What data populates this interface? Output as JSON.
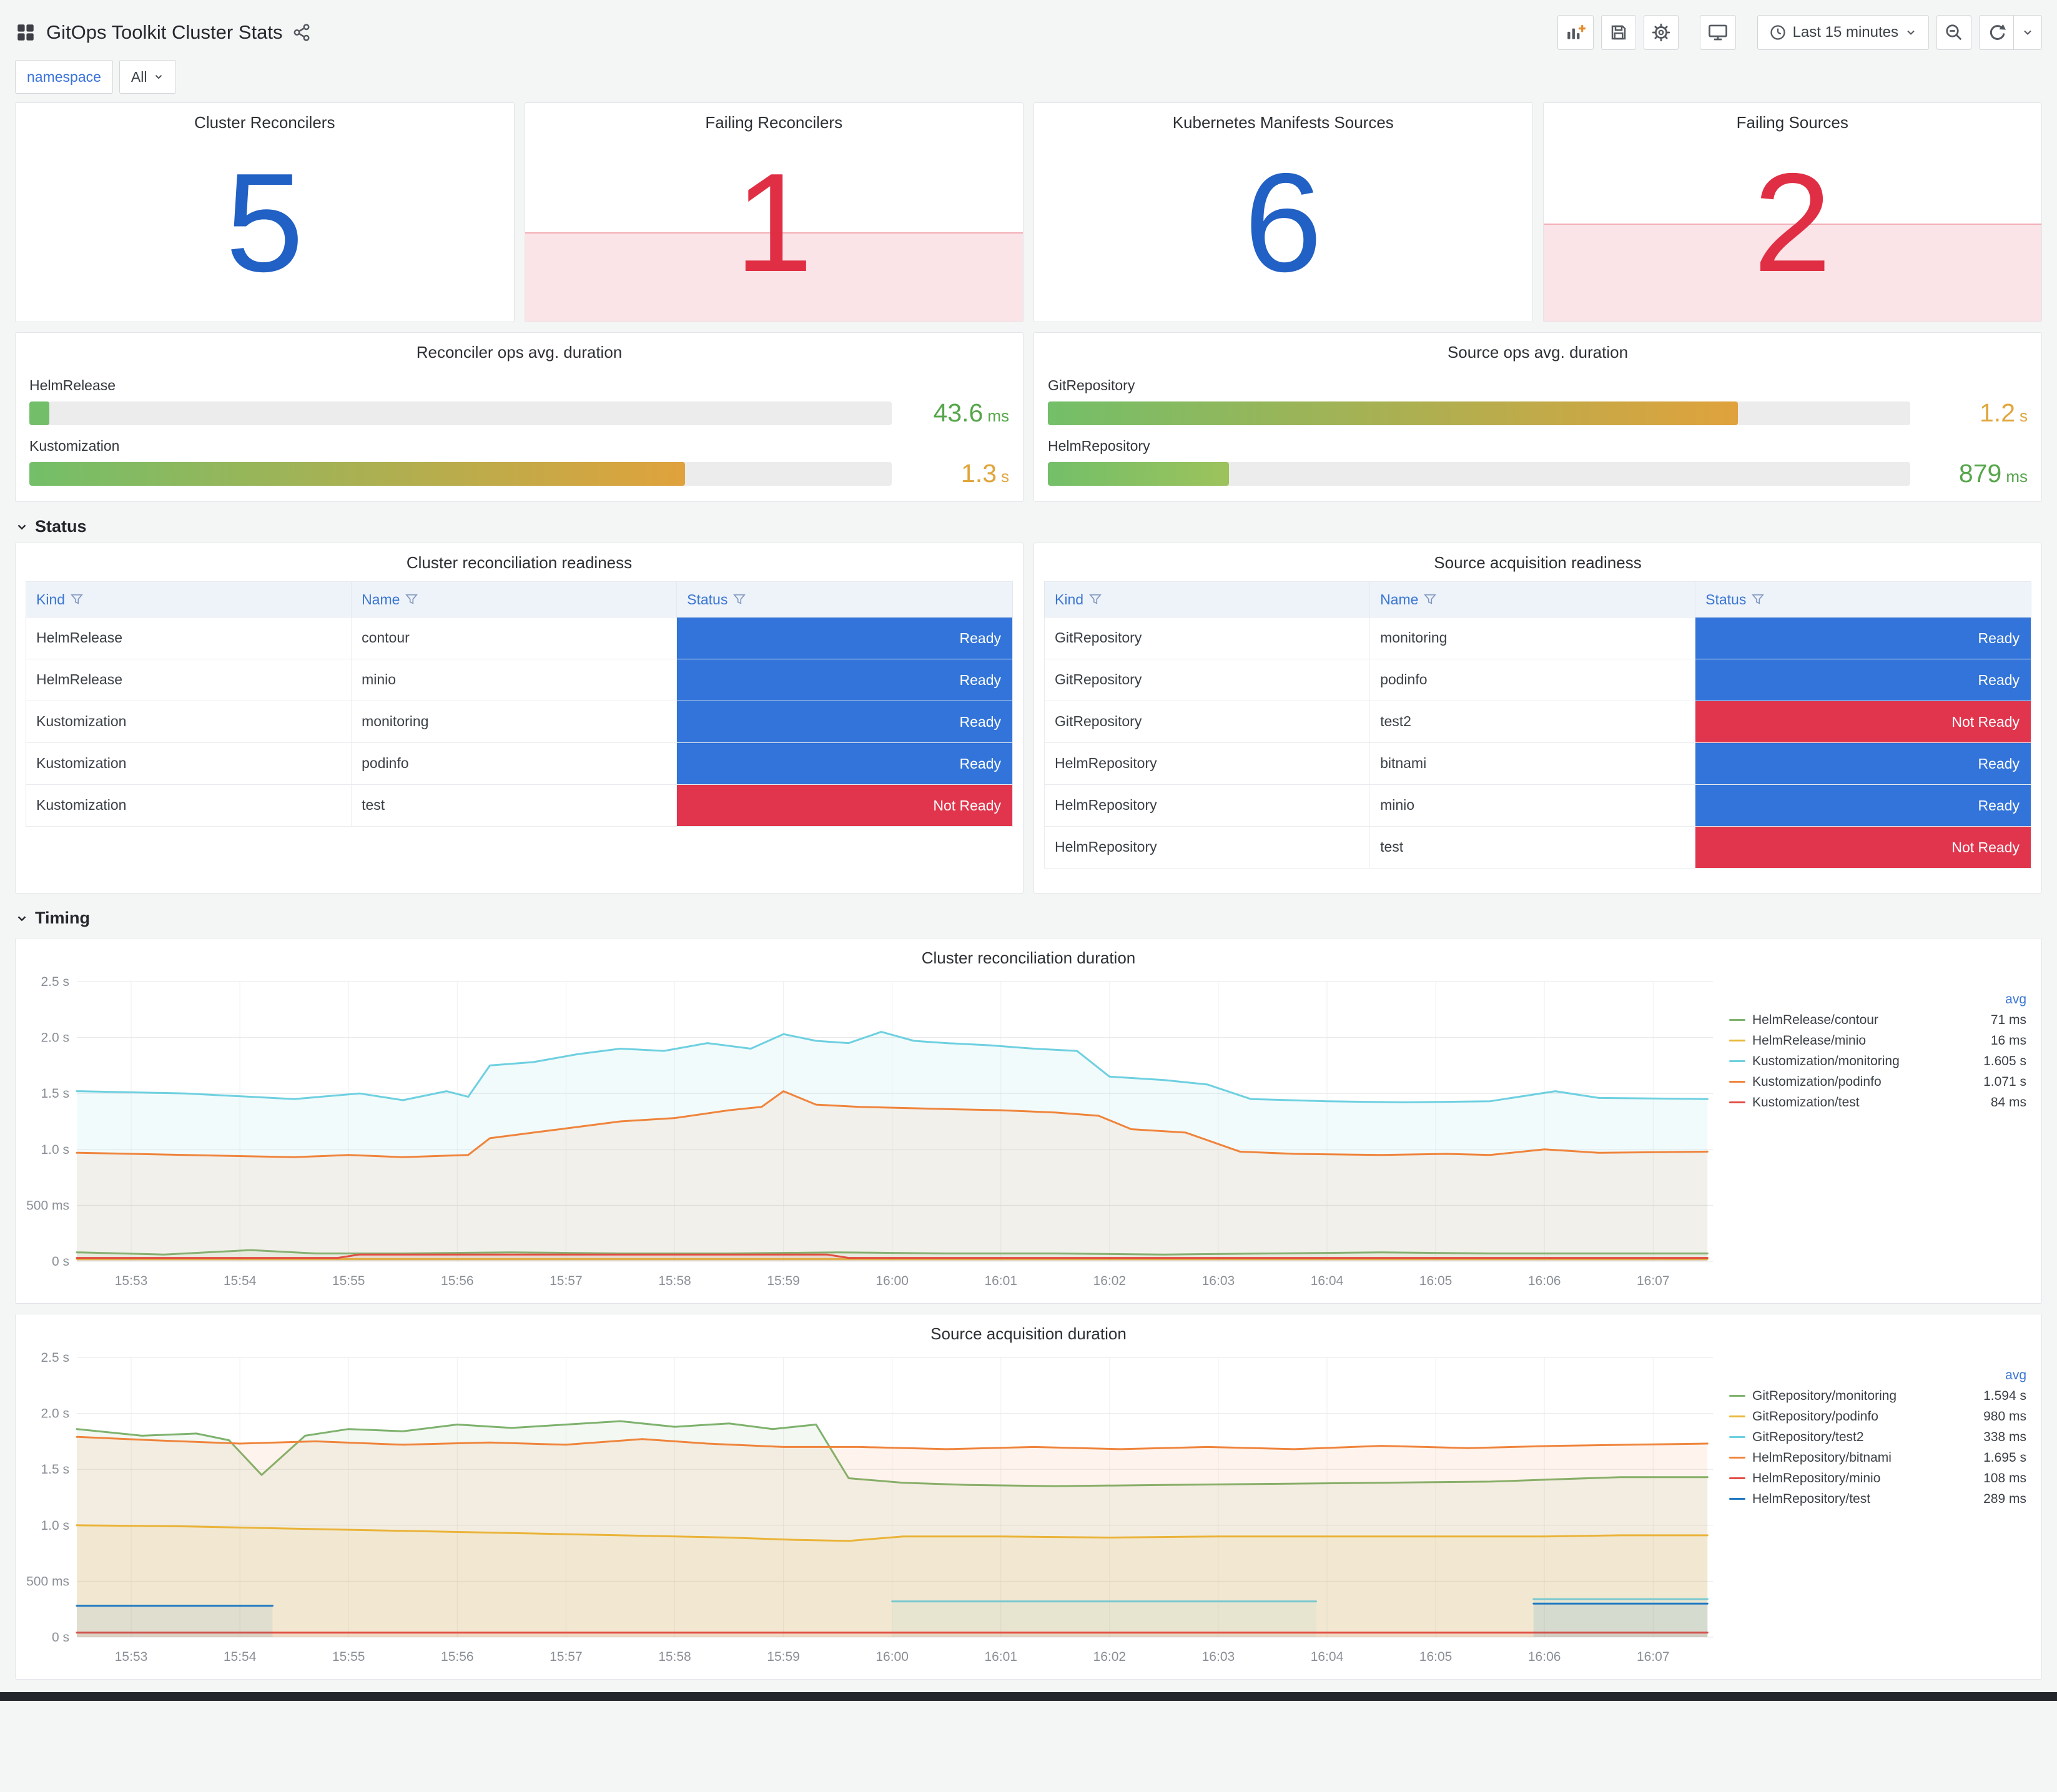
{
  "header": {
    "title": "GitOps Toolkit Cluster Stats",
    "time_range": "Last 15 minutes"
  },
  "variables": {
    "name": "namespace",
    "value": "All"
  },
  "colors": {
    "stat_blue": "#2160c4",
    "stat_red": "#e02f44",
    "link_blue": "#3a76d2"
  },
  "status_styles": {
    "Ready": "#3274d9",
    "Not Ready": "#e0354c"
  },
  "stats": [
    {
      "title": "Cluster Reconcilers",
      "value": "5",
      "tone": "#2160c4",
      "spark_pct": 0
    },
    {
      "title": "Failing Reconcilers",
      "value": "1",
      "tone": "#e02f44",
      "spark_pct": 41
    },
    {
      "title": "Kubernetes Manifests Sources",
      "value": "6",
      "tone": "#2160c4",
      "spark_pct": 0
    },
    {
      "title": "Failing Sources",
      "value": "2",
      "tone": "#e02f44",
      "spark_pct": 45
    }
  ],
  "gauges": [
    {
      "title": "Reconciler ops avg. duration",
      "rows": [
        {
          "label": "HelmRelease",
          "value": "43.6",
          "unit": "ms",
          "pct": 2.3,
          "value_color": "#56a64b",
          "bar_from": "#73bf69",
          "bar_to": "#73bf69"
        },
        {
          "label": "Kustomization",
          "value": "1.3",
          "unit": "s",
          "pct": 76,
          "value_color": "#e0a63c",
          "bar_from": "#73bf69",
          "bar_to": "#e0a23c"
        }
      ]
    },
    {
      "title": "Source ops avg. duration",
      "rows": [
        {
          "label": "GitRepository",
          "value": "1.2",
          "unit": "s",
          "pct": 80,
          "value_color": "#e0a63c",
          "bar_from": "#73bf69",
          "bar_to": "#e0a23c"
        },
        {
          "label": "HelmRepository",
          "value": "879",
          "unit": "ms",
          "pct": 21,
          "value_color": "#56a64b",
          "bar_from": "#73bf69",
          "bar_to": "#9dc25c"
        }
      ]
    }
  ],
  "sections": {
    "status": "Status",
    "timing": "Timing"
  },
  "tables": [
    {
      "title": "Cluster reconciliation readiness",
      "columns": [
        "Kind",
        "Name",
        "Status"
      ],
      "rows": [
        [
          "HelmRelease",
          "contour",
          "Ready"
        ],
        [
          "HelmRelease",
          "minio",
          "Ready"
        ],
        [
          "Kustomization",
          "monitoring",
          "Ready"
        ],
        [
          "Kustomization",
          "podinfo",
          "Ready"
        ],
        [
          "Kustomization",
          "test",
          "Not Ready"
        ]
      ]
    },
    {
      "title": "Source acquisition readiness",
      "columns": [
        "Kind",
        "Name",
        "Status"
      ],
      "rows": [
        [
          "GitRepository",
          "monitoring",
          "Ready"
        ],
        [
          "GitRepository",
          "podinfo",
          "Ready"
        ],
        [
          "GitRepository",
          "test2",
          "Not Ready"
        ],
        [
          "HelmRepository",
          "bitnami",
          "Ready"
        ],
        [
          "HelmRepository",
          "minio",
          "Ready"
        ],
        [
          "HelmRepository",
          "test",
          "Not Ready"
        ]
      ]
    }
  ],
  "chart_data": [
    {
      "type": "line",
      "title": "Cluster reconciliation duration",
      "ylim": [
        0,
        2.5
      ],
      "xlim": [
        0,
        15.05
      ],
      "grid": true,
      "legend_position": "right",
      "legend_header": "avg",
      "yticks": [
        {
          "v": 0,
          "label": "0 s"
        },
        {
          "v": 0.5,
          "label": "500 ms"
        },
        {
          "v": 1,
          "label": "1.0 s"
        },
        {
          "v": 1.5,
          "label": "1.5 s"
        },
        {
          "v": 2,
          "label": "2.0 s"
        },
        {
          "v": 2.5,
          "label": "2.5 s"
        }
      ],
      "xticks": [
        {
          "v": 0.5,
          "label": "15:53"
        },
        {
          "v": 1.5,
          "label": "15:54"
        },
        {
          "v": 2.5,
          "label": "15:55"
        },
        {
          "v": 3.5,
          "label": "15:56"
        },
        {
          "v": 4.5,
          "label": "15:57"
        },
        {
          "v": 5.5,
          "label": "15:58"
        },
        {
          "v": 6.5,
          "label": "15:59"
        },
        {
          "v": 7.5,
          "label": "16:00"
        },
        {
          "v": 8.5,
          "label": "16:01"
        },
        {
          "v": 9.5,
          "label": "16:02"
        },
        {
          "v": 10.5,
          "label": "16:03"
        },
        {
          "v": 11.5,
          "label": "16:04"
        },
        {
          "v": 12.5,
          "label": "16:05"
        },
        {
          "v": 13.5,
          "label": "16:06"
        },
        {
          "v": 14.5,
          "label": "16:07"
        }
      ],
      "series": [
        {
          "name": "HelmRelease/contour",
          "color": "#7eb26d",
          "avg": "71 ms",
          "points": [
            [
              0,
              0.08
            ],
            [
              0.8,
              0.06
            ],
            [
              1.6,
              0.1
            ],
            [
              2.2,
              0.07
            ],
            [
              3,
              0.07
            ],
            [
              4,
              0.08
            ],
            [
              5,
              0.07
            ],
            [
              6,
              0.07
            ],
            [
              7,
              0.08
            ],
            [
              8,
              0.07
            ],
            [
              9,
              0.07
            ],
            [
              10,
              0.06
            ],
            [
              11,
              0.07
            ],
            [
              12,
              0.08
            ],
            [
              13,
              0.07
            ],
            [
              14,
              0.07
            ],
            [
              15,
              0.07
            ]
          ]
        },
        {
          "name": "HelmRelease/minio",
          "color": "#eab839",
          "avg": "16 ms",
          "points": [
            [
              0,
              0.02
            ],
            [
              15,
              0.02
            ]
          ]
        },
        {
          "name": "Kustomization/monitoring",
          "color": "#6ed0e0",
          "avg": "1.605 s",
          "points": [
            [
              0,
              1.52
            ],
            [
              1,
              1.5
            ],
            [
              2,
              1.45
            ],
            [
              2.6,
              1.5
            ],
            [
              3,
              1.44
            ],
            [
              3.4,
              1.52
            ],
            [
              3.6,
              1.47
            ],
            [
              3.8,
              1.75
            ],
            [
              4.2,
              1.78
            ],
            [
              4.6,
              1.85
            ],
            [
              5,
              1.9
            ],
            [
              5.4,
              1.88
            ],
            [
              5.8,
              1.95
            ],
            [
              6.2,
              1.9
            ],
            [
              6.5,
              2.03
            ],
            [
              6.8,
              1.97
            ],
            [
              7.1,
              1.95
            ],
            [
              7.4,
              2.05
            ],
            [
              7.7,
              1.97
            ],
            [
              8,
              1.95
            ],
            [
              8.4,
              1.93
            ],
            [
              8.8,
              1.9
            ],
            [
              9.2,
              1.88
            ],
            [
              9.5,
              1.65
            ],
            [
              10,
              1.62
            ],
            [
              10.4,
              1.58
            ],
            [
              10.8,
              1.45
            ],
            [
              11.5,
              1.43
            ],
            [
              12.2,
              1.42
            ],
            [
              13,
              1.43
            ],
            [
              13.6,
              1.52
            ],
            [
              14,
              1.46
            ],
            [
              15,
              1.45
            ]
          ]
        },
        {
          "name": "Kustomization/podinfo",
          "color": "#ef843c",
          "avg": "1.071 s",
          "points": [
            [
              0,
              0.97
            ],
            [
              1,
              0.95
            ],
            [
              2,
              0.93
            ],
            [
              2.5,
              0.95
            ],
            [
              3,
              0.93
            ],
            [
              3.6,
              0.95
            ],
            [
              3.8,
              1.1
            ],
            [
              4.2,
              1.15
            ],
            [
              4.6,
              1.2
            ],
            [
              5,
              1.25
            ],
            [
              5.5,
              1.28
            ],
            [
              6,
              1.35
            ],
            [
              6.3,
              1.38
            ],
            [
              6.5,
              1.52
            ],
            [
              6.8,
              1.4
            ],
            [
              7.2,
              1.38
            ],
            [
              7.6,
              1.37
            ],
            [
              8,
              1.36
            ],
            [
              8.5,
              1.35
            ],
            [
              9,
              1.33
            ],
            [
              9.4,
              1.3
            ],
            [
              9.7,
              1.18
            ],
            [
              10.2,
              1.15
            ],
            [
              10.7,
              0.98
            ],
            [
              11.2,
              0.96
            ],
            [
              12,
              0.95
            ],
            [
              12.6,
              0.96
            ],
            [
              13,
              0.95
            ],
            [
              13.5,
              1.0
            ],
            [
              14,
              0.97
            ],
            [
              15,
              0.98
            ]
          ]
        },
        {
          "name": "Kustomization/test",
          "color": "#e24d42",
          "avg": "84 ms",
          "points": [
            [
              0,
              0.03
            ],
            [
              2.4,
              0.03
            ],
            [
              2.6,
              0.06
            ],
            [
              6.9,
              0.06
            ],
            [
              7.1,
              0.03
            ],
            [
              15,
              0.03
            ]
          ]
        }
      ]
    },
    {
      "type": "line",
      "title": "Source acquisition duration",
      "ylim": [
        0,
        2.5
      ],
      "xlim": [
        0,
        15.05
      ],
      "grid": true,
      "legend_position": "right",
      "legend_header": "avg",
      "yticks": [
        {
          "v": 0,
          "label": "0 s"
        },
        {
          "v": 0.5,
          "label": "500 ms"
        },
        {
          "v": 1,
          "label": "1.0 s"
        },
        {
          "v": 1.5,
          "label": "1.5 s"
        },
        {
          "v": 2,
          "label": "2.0 s"
        },
        {
          "v": 2.5,
          "label": "2.5 s"
        }
      ],
      "xticks": [
        {
          "v": 0.5,
          "label": "15:53"
        },
        {
          "v": 1.5,
          "label": "15:54"
        },
        {
          "v": 2.5,
          "label": "15:55"
        },
        {
          "v": 3.5,
          "label": "15:56"
        },
        {
          "v": 4.5,
          "label": "15:57"
        },
        {
          "v": 5.5,
          "label": "15:58"
        },
        {
          "v": 6.5,
          "label": "15:59"
        },
        {
          "v": 7.5,
          "label": "16:00"
        },
        {
          "v": 8.5,
          "label": "16:01"
        },
        {
          "v": 9.5,
          "label": "16:02"
        },
        {
          "v": 10.5,
          "label": "16:03"
        },
        {
          "v": 11.5,
          "label": "16:04"
        },
        {
          "v": 12.5,
          "label": "16:05"
        },
        {
          "v": 13.5,
          "label": "16:06"
        },
        {
          "v": 14.5,
          "label": "16:07"
        }
      ],
      "series": [
        {
          "name": "GitRepository/monitoring",
          "color": "#7eb26d",
          "avg": "1.594 s",
          "points": [
            [
              0,
              1.86
            ],
            [
              0.6,
              1.8
            ],
            [
              1.1,
              1.82
            ],
            [
              1.4,
              1.76
            ],
            [
              1.7,
              1.45
            ],
            [
              2.1,
              1.8
            ],
            [
              2.5,
              1.86
            ],
            [
              3,
              1.84
            ],
            [
              3.5,
              1.9
            ],
            [
              4,
              1.87
            ],
            [
              4.5,
              1.9
            ],
            [
              5,
              1.93
            ],
            [
              5.5,
              1.88
            ],
            [
              6,
              1.91
            ],
            [
              6.4,
              1.86
            ],
            [
              6.8,
              1.9
            ],
            [
              7.1,
              1.42
            ],
            [
              7.6,
              1.38
            ],
            [
              8.2,
              1.36
            ],
            [
              9,
              1.35
            ],
            [
              10,
              1.36
            ],
            [
              11,
              1.37
            ],
            [
              12,
              1.38
            ],
            [
              13,
              1.39
            ],
            [
              13.6,
              1.41
            ],
            [
              14.2,
              1.43
            ],
            [
              15,
              1.43
            ]
          ]
        },
        {
          "name": "GitRepository/podinfo",
          "color": "#eab839",
          "avg": "980 ms",
          "points": [
            [
              0,
              1.0
            ],
            [
              1,
              0.99
            ],
            [
              2,
              0.97
            ],
            [
              3,
              0.95
            ],
            [
              4,
              0.93
            ],
            [
              5,
              0.91
            ],
            [
              6,
              0.89
            ],
            [
              6.6,
              0.87
            ],
            [
              7.1,
              0.86
            ],
            [
              7.6,
              0.9
            ],
            [
              8.5,
              0.9
            ],
            [
              9.5,
              0.89
            ],
            [
              10.5,
              0.9
            ],
            [
              11.5,
              0.9
            ],
            [
              12.5,
              0.9
            ],
            [
              13.5,
              0.9
            ],
            [
              14.2,
              0.91
            ],
            [
              15,
              0.91
            ]
          ]
        },
        {
          "name": "GitRepository/test2",
          "color": "#6ed0e0",
          "avg": "338 ms",
          "points": [
            [
              7.5,
              0.32
            ],
            [
              11.4,
              0.32
            ],
            null,
            [
              13.4,
              0.34
            ],
            [
              15,
              0.34
            ]
          ]
        },
        {
          "name": "HelmRepository/bitnami",
          "color": "#ef843c",
          "avg": "1.695 s",
          "points": [
            [
              0,
              1.79
            ],
            [
              0.7,
              1.76
            ],
            [
              1.5,
              1.73
            ],
            [
              2.2,
              1.75
            ],
            [
              3,
              1.72
            ],
            [
              3.8,
              1.74
            ],
            [
              4.5,
              1.72
            ],
            [
              5.2,
              1.77
            ],
            [
              5.8,
              1.73
            ],
            [
              6.5,
              1.7
            ],
            [
              7.2,
              1.7
            ],
            [
              8,
              1.68
            ],
            [
              8.8,
              1.7
            ],
            [
              9.6,
              1.68
            ],
            [
              10.4,
              1.7
            ],
            [
              11.2,
              1.68
            ],
            [
              12,
              1.71
            ],
            [
              12.8,
              1.69
            ],
            [
              13.6,
              1.71
            ],
            [
              14.3,
              1.72
            ],
            [
              15,
              1.73
            ]
          ]
        },
        {
          "name": "HelmRepository/minio",
          "color": "#e24d42",
          "avg": "108 ms",
          "points": [
            [
              0,
              0.04
            ],
            [
              15,
              0.04
            ]
          ]
        },
        {
          "name": "HelmRepository/test",
          "color": "#1f78c1",
          "avg": "289 ms",
          "points": [
            [
              0,
              0.28
            ],
            [
              1.8,
              0.28
            ],
            null,
            [
              13.4,
              0.3
            ],
            [
              15,
              0.3
            ]
          ]
        }
      ]
    }
  ]
}
